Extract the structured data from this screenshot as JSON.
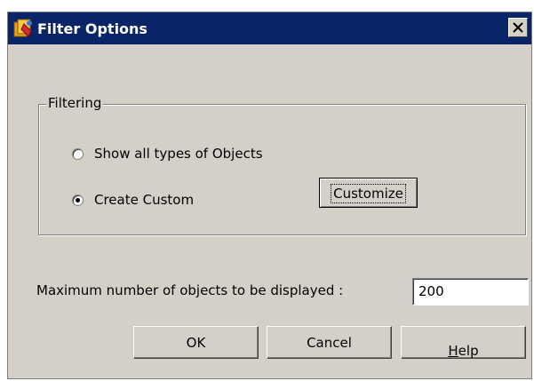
{
  "window": {
    "title": "Filter Options",
    "title_bar_color": "#0a246a",
    "background_color": "#d4d0c8",
    "app_icon": "filter-app-icon",
    "close_icon": "close-icon"
  },
  "filtering_group": {
    "label": "Filtering",
    "options": [
      {
        "label": "Show all types of Objects",
        "selected": false
      },
      {
        "label": "Create Custom",
        "selected": true
      }
    ],
    "customize_button": "Customize"
  },
  "max_objects": {
    "label": "Maximum number of objects to be displayed :",
    "value": "200"
  },
  "buttons": {
    "ok": "OK",
    "cancel": "Cancel",
    "help_prefix": "",
    "help_mnemonic": "H",
    "help_rest": "elp"
  }
}
